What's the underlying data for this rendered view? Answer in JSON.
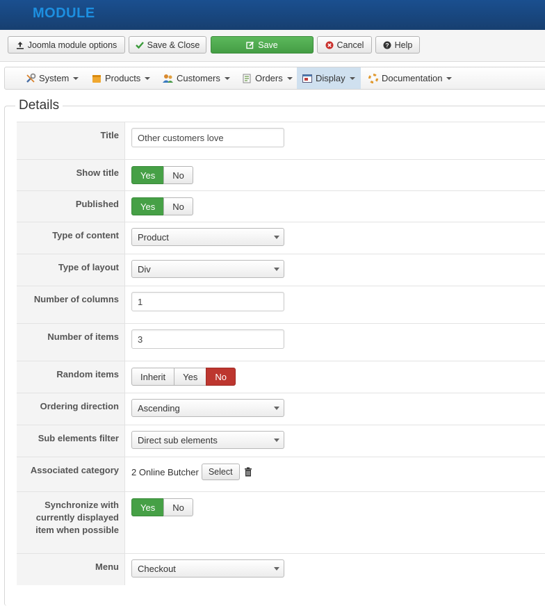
{
  "header": {
    "title": "MODULE"
  },
  "toolbar": {
    "joomla_options": "Joomla module options",
    "save_close": "Save & Close",
    "save": "Save",
    "cancel": "Cancel",
    "help": "Help"
  },
  "menu": {
    "items": [
      {
        "label": "System",
        "icon": "wrench-icon"
      },
      {
        "label": "Products",
        "icon": "box-icon"
      },
      {
        "label": "Customers",
        "icon": "users-icon"
      },
      {
        "label": "Orders",
        "icon": "document-icon"
      },
      {
        "label": "Display",
        "icon": "display-icon"
      },
      {
        "label": "Documentation",
        "icon": "lifebuoy-icon"
      }
    ],
    "active": "Display"
  },
  "details": {
    "legend": "Details",
    "title": {
      "label": "Title",
      "value": "Other customers love"
    },
    "show_title": {
      "label": "Show title",
      "options": [
        "Yes",
        "No"
      ],
      "selected": "Yes"
    },
    "published": {
      "label": "Published",
      "options": [
        "Yes",
        "No"
      ],
      "selected": "Yes"
    },
    "type_of_content": {
      "label": "Type of content",
      "value": "Product"
    },
    "type_of_layout": {
      "label": "Type of layout",
      "value": "Div"
    },
    "number_of_columns": {
      "label": "Number of columns",
      "value": "1"
    },
    "number_of_items": {
      "label": "Number of items",
      "value": "3"
    },
    "random_items": {
      "label": "Random items",
      "options": [
        "Inherit",
        "Yes",
        "No"
      ],
      "selected": "No"
    },
    "ordering_direction": {
      "label": "Ordering direction",
      "value": "Ascending"
    },
    "sub_elements_filter": {
      "label": "Sub elements filter",
      "value": "Direct sub elements"
    },
    "associated_category": {
      "label": "Associated category",
      "value": "2 Online Butcher",
      "select_label": "Select"
    },
    "synchronize": {
      "label": "Synchronize with currently displayed item when possible",
      "options": [
        "Yes",
        "No"
      ],
      "selected": "Yes"
    },
    "menu": {
      "label": "Menu",
      "value": "Checkout"
    }
  },
  "colors": {
    "header_bg": "#173f70",
    "brand_text": "#1d8fe0",
    "toggle_on_green": "#46a046",
    "toggle_on_red": "#bd362f",
    "active_menu": "#cfe0ef"
  }
}
